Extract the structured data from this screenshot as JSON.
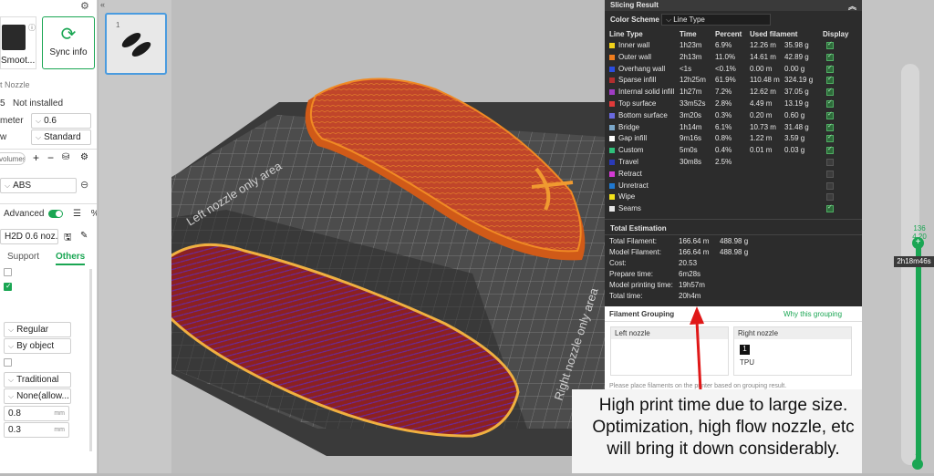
{
  "left_panel": {
    "preset_label": "Smoot...",
    "sync_label": "Sync info",
    "nozzle_section": "t Nozzle",
    "nozzle_status_num": "5",
    "nozzle_status": "Not installed",
    "diameter_label": "meter",
    "diameter_value": "0.6",
    "flow_label": "w",
    "flow_value": "Standard",
    "volumes_label": "volumes",
    "filament_name": "ABS",
    "advanced_label": "Advanced",
    "process_name": "H2D 0.6 noz...",
    "tab_support": "Support",
    "tab_others": "Others",
    "opt_regular": "Regular",
    "opt_by_object": "By object",
    "opt_traditional": "Traditional",
    "opt_none": "None(allow...",
    "val1": "0.8",
    "unit1": "mm",
    "val2": "0.3",
    "unit2": "mm"
  },
  "viewport": {
    "bed_label_left": "Left nozzle only area",
    "bed_label_right": "Right nozzle only area"
  },
  "slicing": {
    "title": "Slicing Result",
    "color_scheme_label": "Color Scheme",
    "color_scheme_value": "Line Type",
    "headers": [
      "Line Type",
      "Time",
      "Percent",
      "Used filament",
      "",
      "Display"
    ],
    "rows": [
      {
        "name": "Inner wall",
        "color": "#f2d21a",
        "time": "1h23m",
        "pct": "6.9%",
        "len": "12.26 m",
        "wt": "35.98 g",
        "on": true
      },
      {
        "name": "Outer wall",
        "color": "#f07d1d",
        "time": "2h13m",
        "pct": "11.0%",
        "len": "14.61 m",
        "wt": "42.89 g",
        "on": true
      },
      {
        "name": "Overhang wall",
        "color": "#2b4de0",
        "time": "<1s",
        "pct": "<0.1%",
        "len": "0.00 m",
        "wt": "0.00 g",
        "on": true
      },
      {
        "name": "Sparse infill",
        "color": "#b22e2e",
        "time": "12h25m",
        "pct": "61.9%",
        "len": "110.48 m",
        "wt": "324.19 g",
        "on": true
      },
      {
        "name": "Internal solid infill",
        "color": "#a03cc4",
        "time": "1h27m",
        "pct": "7.2%",
        "len": "12.62 m",
        "wt": "37.05 g",
        "on": true
      },
      {
        "name": "Top surface",
        "color": "#e03a3a",
        "time": "33m52s",
        "pct": "2.8%",
        "len": "4.49 m",
        "wt": "13.19 g",
        "on": true
      },
      {
        "name": "Bottom surface",
        "color": "#6a6ae0",
        "time": "3m20s",
        "pct": "0.3%",
        "len": "0.20 m",
        "wt": "0.60 g",
        "on": true
      },
      {
        "name": "Bridge",
        "color": "#7aa6c8",
        "time": "1h14m",
        "pct": "6.1%",
        "len": "10.73 m",
        "wt": "31.48 g",
        "on": true
      },
      {
        "name": "Gap infill",
        "color": "#ffffff",
        "time": "9m16s",
        "pct": "0.8%",
        "len": "1.22 m",
        "wt": "3.59 g",
        "on": true
      },
      {
        "name": "Custom",
        "color": "#2fc07a",
        "time": "5m0s",
        "pct": "0.4%",
        "len": "0.01 m",
        "wt": "0.03 g",
        "on": true
      },
      {
        "name": "Travel",
        "color": "#2a3ab8",
        "time": "30m8s",
        "pct": "2.5%",
        "len": "",
        "wt": "",
        "on": false
      },
      {
        "name": "Retract",
        "color": "#d43ad4",
        "time": "",
        "pct": "",
        "len": "",
        "wt": "",
        "on": false
      },
      {
        "name": "Unretract",
        "color": "#1f78d0",
        "time": "",
        "pct": "",
        "len": "",
        "wt": "",
        "on": false
      },
      {
        "name": "Wipe",
        "color": "#f2e21a",
        "time": "",
        "pct": "",
        "len": "",
        "wt": "",
        "on": false
      },
      {
        "name": "Seams",
        "color": "#e6e6e6",
        "time": "",
        "pct": "",
        "len": "",
        "wt": "",
        "on": true
      }
    ],
    "total_title": "Total Estimation",
    "totals": [
      {
        "label": "Total Filament:",
        "v1": "166.64 m",
        "v2": "488.98 g"
      },
      {
        "label": "Model Filament:",
        "v1": "166.64 m",
        "v2": "488.98 g"
      },
      {
        "label": "Cost:",
        "v1": "20.53",
        "v2": ""
      },
      {
        "label": "Prepare time:",
        "v1": "6m28s",
        "v2": ""
      },
      {
        "label": "Model printing time:",
        "v1": "19h57m",
        "v2": ""
      },
      {
        "label": "Total time:",
        "v1": "20h4m",
        "v2": ""
      }
    ]
  },
  "grouping": {
    "title": "Filament Grouping",
    "why": "Why this grouping",
    "left": "Left nozzle",
    "right": "Right nozzle",
    "slot": "1",
    "material": "TPU",
    "hint": "Please place filaments on the printer based on grouping result."
  },
  "annotation": {
    "line1": "High print time due to large size.",
    "line2": "Optimization, high flow nozzle, etc",
    "line3": "will bring it down considerably."
  },
  "layer_slider": {
    "top_layer": "136",
    "top_height": "4.20",
    "time_badge": "2h18m46s",
    "bottom_layer": "1"
  }
}
